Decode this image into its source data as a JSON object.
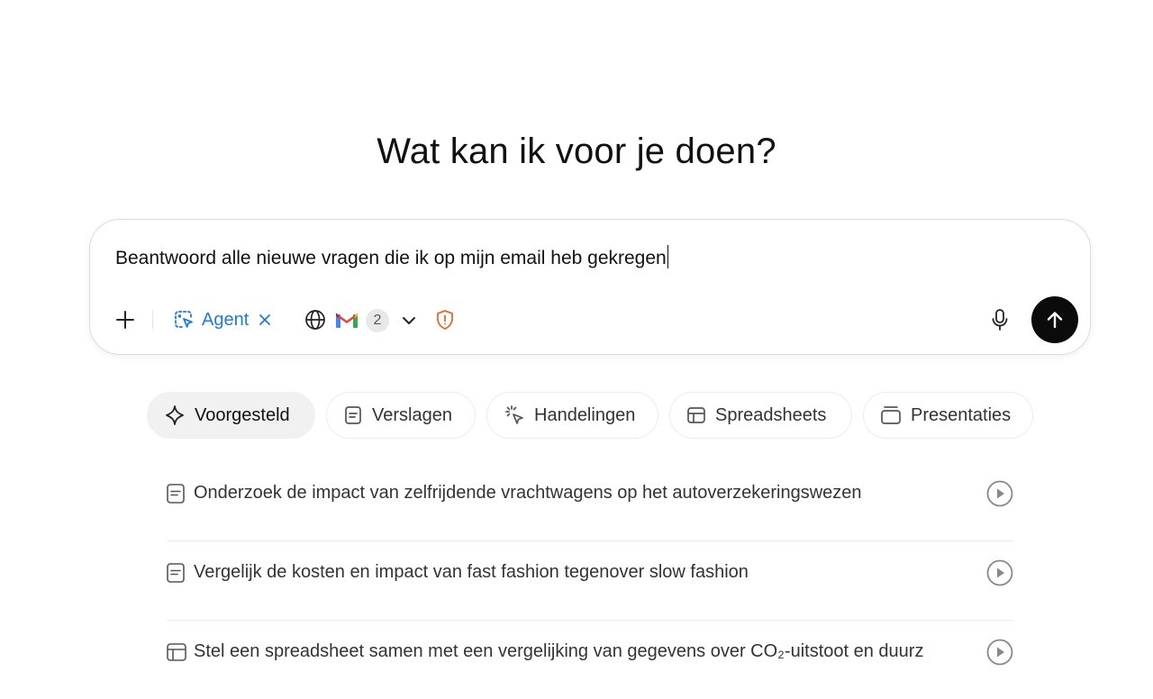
{
  "heading": "Wat kan ik voor je doen?",
  "composer": {
    "input_value": "Beantwoord alle nieuwe vragen die ik op mijn email heb gekregen",
    "agent_label": "Agent",
    "connector_count": "2"
  },
  "tabs": [
    {
      "label": "Voorgesteld",
      "icon": "sparkle-icon",
      "active": true
    },
    {
      "label": "Verslagen",
      "icon": "document-icon",
      "active": false
    },
    {
      "label": "Handelingen",
      "icon": "cursor-click-icon",
      "active": false
    },
    {
      "label": "Spreadsheets",
      "icon": "table-icon",
      "active": false
    },
    {
      "label": "Presentaties",
      "icon": "slides-icon",
      "active": false
    }
  ],
  "suggestions": [
    {
      "text": "Onderzoek de impact van zelfrijdende vrachtwagens op het autoverzekeringswezen",
      "icon": "document-icon"
    },
    {
      "text": "Vergelijk de kosten en impact van fast fashion tegenover slow fashion",
      "icon": "document-icon"
    },
    {
      "text": "Stel een spreadsheet samen met een vergelijking van gegevens over CO₂-uitstoot en duurz",
      "icon": "table-icon"
    }
  ],
  "colors": {
    "accent": "#1f7ae0",
    "send_button": "#0b0b0b",
    "shield": "#e8662a",
    "active_tab_bg": "#f1f1f1"
  }
}
